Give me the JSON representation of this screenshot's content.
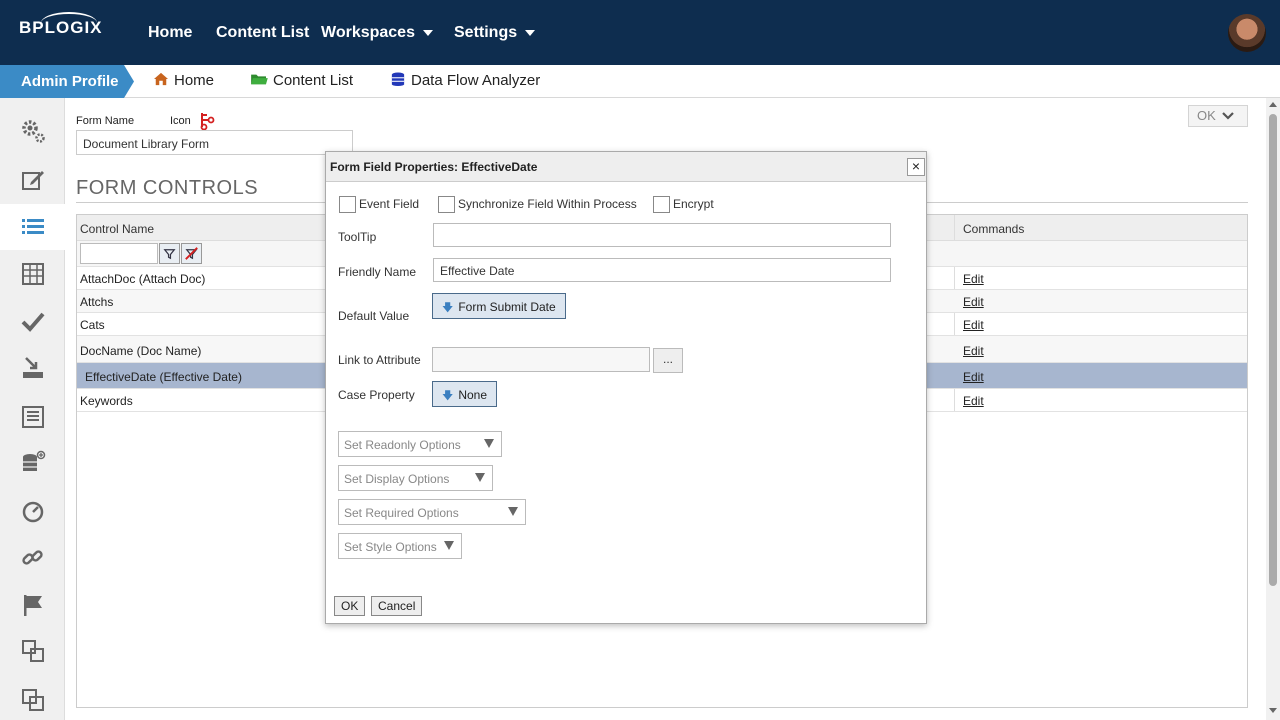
{
  "topbar": {
    "logo": "BPLOGIX",
    "nav": [
      "Home",
      "Content List",
      "Workspaces",
      "Settings"
    ]
  },
  "crumbs": {
    "admin": "Admin Profile",
    "items": [
      "Home",
      "Content List",
      "Data Flow Analyzer"
    ]
  },
  "form": {
    "name_label": "Form Name",
    "icon_label": "Icon",
    "name_value": "Document Library Form",
    "ok_button": "OK",
    "section_title": "FORM CONTROLS"
  },
  "grid": {
    "col_control": "Control Name",
    "col_commands": "Commands",
    "rows": [
      {
        "name": "AttachDoc (Attach Doc)",
        "cmd": "Edit"
      },
      {
        "name": "Attchs",
        "cmd": "Edit"
      },
      {
        "name": "Cats",
        "cmd": "Edit"
      },
      {
        "name": "DocName (Doc Name)",
        "cmd": "Edit"
      },
      {
        "name": "EffectiveDate (Effective Date)",
        "cmd": "Edit"
      },
      {
        "name": "Keywords",
        "cmd": "Edit"
      }
    ]
  },
  "dialog": {
    "title": "Form Field Properties: EffectiveDate",
    "close": "×",
    "event_field": "Event Field",
    "sync_field": "Synchronize Field Within Process",
    "encrypt": "Encrypt",
    "tooltip_label": "ToolTip",
    "friendly_label": "Friendly Name",
    "friendly_value": "Effective Date",
    "default_label": "Default Value",
    "default_btn": "Form Submit Date",
    "link_label": "Link to Attribute",
    "ellipsis": "...",
    "case_label": "Case Property",
    "case_btn": "None",
    "readonly": "Set Readonly Options",
    "display": "Set Display Options",
    "required": "Set Required Options",
    "style": "Set Style Options",
    "ok": "OK",
    "cancel": "Cancel"
  }
}
